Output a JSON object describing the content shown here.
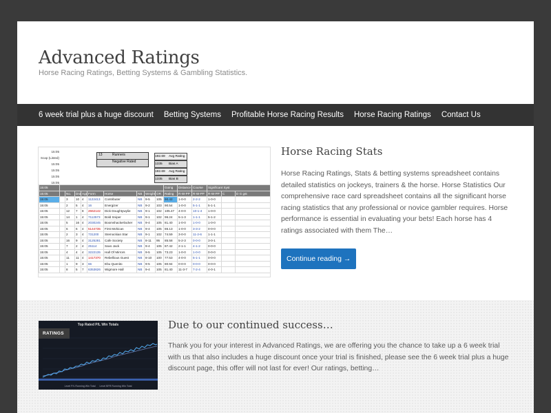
{
  "site": {
    "title": "Advanced Ratings",
    "tagline": "Horse Racing Ratings, Betting Systems & Gambling Statistics."
  },
  "nav": {
    "items": [
      {
        "label": "6 week trial plus a huge discount"
      },
      {
        "label": "Betting Systems"
      },
      {
        "label": "Profitable Horse Racing Results"
      },
      {
        "label": "Horse Racing Ratings"
      },
      {
        "label": "Contact Us"
      }
    ]
  },
  "posts": [
    {
      "title": "Horse Racing Stats",
      "excerpt": "Horse Racing Ratings, Stats & betting systems spreadsheet contains detailed statistics on jockeys, trainers & the horse. Horse Statistics Our comprehensive race card spreadsheet contains all the significant horse racing statistics that any professional or novice gambler requires. Horse performance is essential in evaluating your bets! Each horse has 4 ratings associated with them The…",
      "button_label": "Continue reading →"
    },
    {
      "title": "Due to our continued success…",
      "excerpt": "Thank you for your interest in Advanced Ratings, we are offering you the chance to take up a 6 week trial with us that also includes a huge discount once your trial is finished, please see the 6 week trial plus a huge discount page, this offer will not last for ever! Our ratings, betting…"
    }
  ],
  "thumbnail1": {
    "summary_boxes": [
      {
        "value": "13",
        "label": "Runners"
      },
      {
        "value": "",
        "label": "Negative Rated"
      }
    ],
    "summary_ratings": [
      {
        "value": "192.69",
        "label": "Avg Rating"
      },
      {
        "value": "1335",
        "label": "Bias A"
      },
      {
        "value": "192.69",
        "label": "Avg Rating"
      },
      {
        "value": "1335",
        "label": "Bias B"
      }
    ],
    "side_label": "Scap (Listed)",
    "headers": [
      "No.",
      "Draw",
      "Age",
      "Form",
      "Horse",
      "NB",
      "Weight",
      "OR",
      "Rating",
      "R-W-PP",
      "R-W-PP",
      "R-W-PP",
      "C",
      "D",
      "G",
      "gst"
    ],
    "group_headers": [
      "Going",
      "Distance",
      "Course",
      "Significant Syst"
    ],
    "rows": [
      [
        "3",
        "10",
        "4",
        "1122413",
        "Contributer",
        "NB",
        "9-5",
        "105",
        "90.42",
        "1-0-0",
        "2-2-2",
        "1-0-0"
      ],
      [
        "2",
        "5",
        "4",
        "16",
        "Energizer",
        "NB",
        "9-2",
        "103",
        "90.54",
        "1-0-0",
        "5-1-1",
        "5-1-1"
      ],
      [
        "12",
        "7",
        "8",
        "2662142",
        "Dick Doughtywylie",
        "NB",
        "9-1",
        "102",
        "105.47",
        "4-0-0",
        "10-1-4",
        "1-0-0"
      ],
      [
        "14",
        "1",
        "4",
        "7112573",
        "Bold Sniper",
        "NB",
        "9-1",
        "102",
        "96.24",
        "5-1-3",
        "1-1-1",
        "5-1-2"
      ],
      [
        "5",
        "16",
        "4",
        "2030245",
        "Boomshackerlacker",
        "NB",
        "9-4",
        "105",
        "81.40",
        "1-0-0",
        "1-0-0",
        "1-0-0"
      ],
      [
        "6",
        "6",
        "4",
        "5144735",
        "First Mohican",
        "NB",
        "9-4",
        "105",
        "86.13",
        "1-0-0",
        "3-3-2",
        "0-0-0"
      ],
      [
        "2",
        "3",
        "4",
        "731200",
        "Stemockian Star",
        "NB",
        "9-1",
        "102",
        "74.59",
        "3-0-0",
        "11-2-6",
        "1-1-1"
      ],
      [
        "16",
        "9",
        "4",
        "3125281",
        "Cafe Society",
        "NB",
        "8-11",
        "95",
        "85.58",
        "5-2-3",
        "0-0-0",
        "3-0-1"
      ],
      [
        "7",
        "2",
        "4",
        "25114",
        "Savo Jack",
        "NB",
        "9-4",
        "105",
        "87.42",
        "2-1-1",
        "4-1-2",
        "0-0-0"
      ],
      [
        "4",
        "4",
        "4",
        "3222135",
        "Hall Of Mirrors",
        "NB",
        "9-5",
        "105",
        "73.23",
        "1-0-0",
        "1-0-0",
        "0-0-0"
      ],
      [
        "11",
        "11",
        "4",
        "1417370",
        "Rebellious Guest",
        "NB",
        "8-10",
        "100",
        "77.53",
        "4-0-0",
        "5-1-1",
        "0-0-0"
      ],
      [
        "1",
        "9",
        "3",
        "66",
        "Ebu Quenito",
        "NB",
        "9-5",
        "105",
        "80.94",
        "0-0-0",
        "0-0-0",
        "0-0-0"
      ],
      [
        "8",
        "5",
        "7",
        "6353626",
        "Wigmore Hall",
        "NB",
        "9-4",
        "105",
        "81.40",
        "11-3-7",
        "7-2-4",
        "4-0-1"
      ]
    ]
  },
  "thumbnail2": {
    "badge": "RATINGS",
    "chart_title": "Top Rated P/L Win Totals",
    "legend": [
      "Level P/L Running Win Total",
      "Level BFR Running Win Total"
    ]
  }
}
